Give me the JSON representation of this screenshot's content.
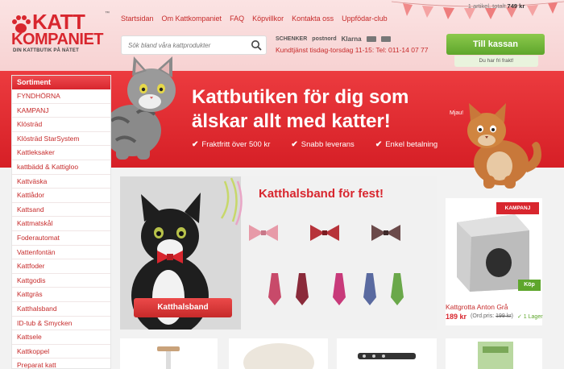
{
  "logo": {
    "line1": "KATT",
    "tm": "™",
    "line2": "KOMPANIET",
    "tagline": "DIN KATTBUTIK PÅ NÄTET"
  },
  "topnav": [
    "Startsidan",
    "Om Kattkompaniet",
    "FAQ",
    "Köpvillkor",
    "Kontakta oss",
    "Uppfödar-club"
  ],
  "search": {
    "placeholder": "Sök bland våra kattprodukter"
  },
  "partners": [
    "SCHENKER",
    "postnord",
    "Klarna"
  ],
  "customer_service": "Kundtjänst tisdag-torsdag 11-15: Tel: 011-14 07 77",
  "cart": {
    "summary": "1 artikel, totalt",
    "total": "749 kr",
    "checkout_label": "Till kassan",
    "free_shipping": "Du har fri frakt!"
  },
  "banner": {
    "title_line1": "Kattbutiken för dig som",
    "title_line2": "älskar allt med katter!",
    "perks": [
      "Fraktfritt över 500 kr",
      "Snabb leverans",
      "Enkel betalning"
    ],
    "cat_speech": "Mjau!"
  },
  "sidebar": {
    "title": "Sortiment",
    "items": [
      "FYNDHÖRNA",
      "KAMPANJ",
      "Klösträd",
      "Klösträd StarSystem",
      "Kattleksaker",
      "kattbädd & Kattigloo",
      "Kattväska",
      "Kattlådor",
      "Kattsand",
      "Kattmatskål",
      "Foderautomat",
      "Vattenfontän",
      "Kattfoder",
      "Kattgodis",
      "Kattgräs",
      "Katthalsband",
      "ID-tub & Smycken",
      "Kattsele",
      "Kattkoppel",
      "Preparat katt"
    ]
  },
  "promo": {
    "title": "Katthalsband för fest!",
    "button": "Katthalsband"
  },
  "product": {
    "badge": "KAMPANJ",
    "buy_label": "Köp",
    "name": "Kattgrotta Anton Grå",
    "price": "189 kr",
    "old_price_prefix": "(Ord.pris:",
    "old_price": "199 kr",
    "old_price_suffix": ")",
    "stock": "✓ 1 Lager"
  },
  "colors": {
    "brand_red": "#d8262e",
    "buy_green": "#5ea62c",
    "header_pink": "#f9dcdc"
  }
}
